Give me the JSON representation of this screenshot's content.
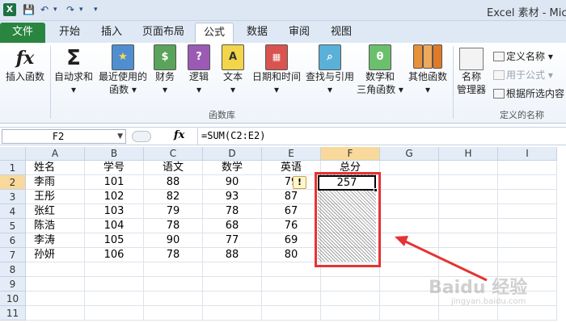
{
  "window": {
    "title": "Excel 素材 - Micro"
  },
  "qat": {
    "save": "💾",
    "undo": "↶",
    "redo": "↷",
    "more": "▾"
  },
  "tabs": [
    "文件",
    "开始",
    "插入",
    "页面布局",
    "公式",
    "数据",
    "审阅",
    "视图"
  ],
  "ribbon": {
    "insert_function": "插入函数",
    "autosum": "自动求和",
    "recent": [
      "最近使用的",
      "函数 ▾"
    ],
    "financial": "财务",
    "logical": "逻辑",
    "text": "文本",
    "datetime": "日期和时间",
    "lookup": "查找与引用",
    "math": [
      "数学和",
      "三角函数 ▾"
    ],
    "more": "其他函数",
    "group_library": "函数库",
    "name_manager": [
      "名称",
      "管理器"
    ],
    "define_name": "定义名称 ▾",
    "use_in_formula": "用于公式 ▾",
    "create_from_selection": "根据所选内容",
    "group_names": "定义的名称"
  },
  "formula_bar": {
    "name_box": "F2",
    "fx": "fx",
    "formula": "=SUM(C2:E2)"
  },
  "sheet": {
    "columns": [
      "A",
      "B",
      "C",
      "D",
      "E",
      "F",
      "G",
      "H",
      "I"
    ],
    "rows": [
      "1",
      "2",
      "3",
      "4",
      "5",
      "6",
      "7",
      "8",
      "9",
      "10",
      "11"
    ],
    "headers": [
      "姓名",
      "学号",
      "语文",
      "数学",
      "英语",
      "总分"
    ],
    "data": [
      [
        "李雨",
        "101",
        "88",
        "90",
        "79"
      ],
      [
        "王彤",
        "102",
        "82",
        "93",
        "87"
      ],
      [
        "张红",
        "103",
        "79",
        "78",
        "67"
      ],
      [
        "陈浩",
        "104",
        "78",
        "68",
        "76"
      ],
      [
        "李涛",
        "105",
        "90",
        "77",
        "69"
      ],
      [
        "孙妍",
        "106",
        "78",
        "88",
        "80"
      ]
    ],
    "active_cell_value": "257",
    "selected_column": "F",
    "selected_row": "2"
  },
  "watermark": {
    "main": "Baidu 经验",
    "sub": "jingyan.baidu.com"
  },
  "colors": {
    "file_tab": "#2a8540",
    "highlight_box": "#e53333",
    "arrow": "#e53333",
    "selected_header": "#f9d99b"
  }
}
